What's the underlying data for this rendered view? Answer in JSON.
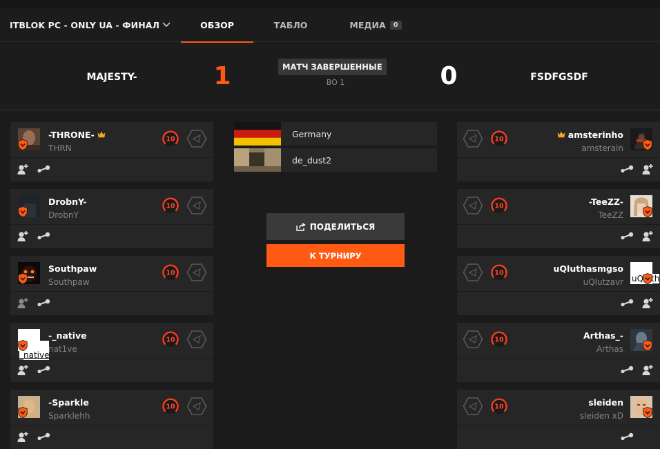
{
  "nav": {
    "title": "ITBLOK PC - ONLY UA - ФИНАЛ",
    "tabs": [
      {
        "label": "ОБЗОР"
      },
      {
        "label": "ТАБЛО"
      },
      {
        "label": "МЕДИА",
        "badge": "0"
      }
    ]
  },
  "match": {
    "team_left": "MAJESTY-",
    "score_left": "1",
    "status": "МАТЧ ЗАВЕРШЕННЫЕ",
    "format": "BO 1",
    "score_right": "0",
    "team_right": "FSDFGSDF"
  },
  "left_team": [
    {
      "nick": "-THRONE-",
      "name": "THRN",
      "level": "10",
      "captain": true
    },
    {
      "nick": "DrobnY-",
      "name": "DrobnY",
      "level": "10"
    },
    {
      "nick": "Southpaw",
      "name": "Southpaw",
      "level": "10"
    },
    {
      "nick": "-_native",
      "name": "nat1ve",
      "level": "10",
      "avatar_alt": "-_native"
    },
    {
      "nick": "-Sparkle",
      "name": "Sparklehh",
      "level": "10"
    }
  ],
  "right_team": [
    {
      "nick": "amsterinho",
      "name": "amsterain",
      "level": "10",
      "captain": true
    },
    {
      "nick": "-TeeZZ-",
      "name": "TeeZZ",
      "level": "10"
    },
    {
      "nick": "uQluthasmgso",
      "name": "uQlutzavr",
      "level": "10",
      "avatar_alt": "uQluth"
    },
    {
      "nick": "Arthas_-",
      "name": "Arthas",
      "level": "10"
    },
    {
      "nick": "sleiden",
      "name": "sleiden xD",
      "level": "10"
    }
  ],
  "match_info": {
    "location": "Germany",
    "map": "de_dust2"
  },
  "buttons": {
    "share": "ПОДЕЛИТЬСЯ",
    "tournament": "К ТУРНИРУ"
  },
  "colors": {
    "accent": "#ff5a13",
    "captain_crown": "#f5a623",
    "background": "#1b1b1b",
    "card": "#262626"
  }
}
